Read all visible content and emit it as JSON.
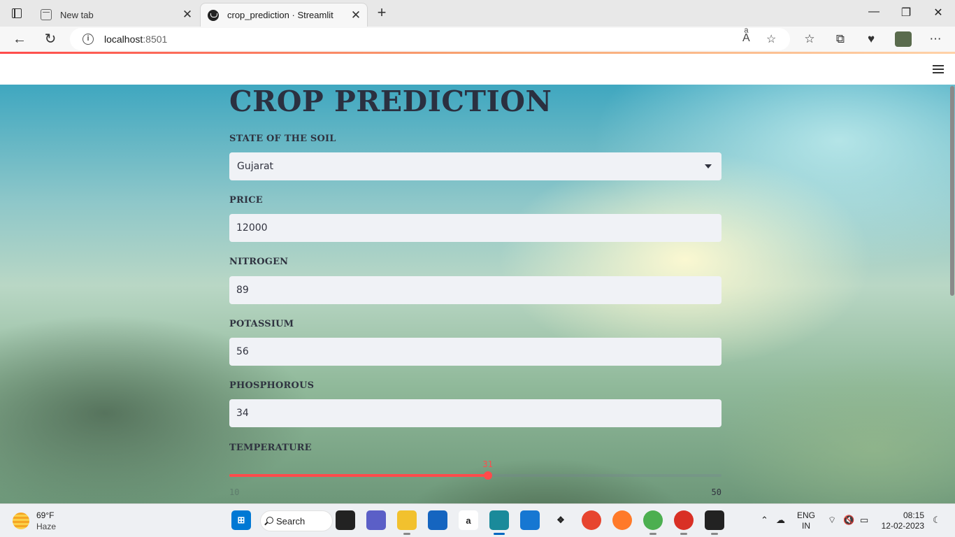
{
  "browser": {
    "tabs": [
      {
        "title": "New tab",
        "active": false
      },
      {
        "title": "crop_prediction · Streamlit",
        "active": true
      }
    ],
    "new_tab": "+",
    "close_glyph": "✕",
    "window_controls": {
      "minimize": "—",
      "maximize": "❐",
      "close": "✕"
    },
    "url_host": "localhost",
    "url_port": ":8501",
    "info_glyph": "i"
  },
  "app": {
    "title": "CROP PREDICTION",
    "fields": {
      "state": {
        "label": "STATE OF THE SOIL",
        "value": "Gujarat"
      },
      "price": {
        "label": "PRICE",
        "value": "12000"
      },
      "nitrogen": {
        "label": "NITROGEN",
        "value": "89"
      },
      "potassium": {
        "label": "POTASSIUM",
        "value": "56"
      },
      "phosphorous": {
        "label": "PHOSPHOROUS",
        "value": "34"
      }
    },
    "temperature": {
      "label": "TEMPERATURE",
      "value": 31,
      "min": 10,
      "max": 50
    },
    "accent_color": "#ff4b4b"
  },
  "taskbar": {
    "weather_temp": "69°F",
    "weather_cond": "Haze",
    "search_label": "Search",
    "lang_line1": "ENG",
    "lang_line2": "IN",
    "time": "08:15",
    "date": "12-02-2023"
  }
}
